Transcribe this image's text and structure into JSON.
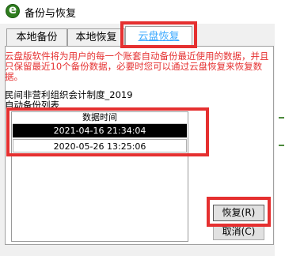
{
  "window": {
    "title": "备份与恢复",
    "icon": "app-e-icon"
  },
  "tabs": [
    {
      "label": "本地备份"
    },
    {
      "label": "本地恢复"
    },
    {
      "label": "云盘恢复"
    }
  ],
  "active_tab": "云盘恢复",
  "notice": "云盘版软件将为用户的每一个账套自动备份最近使用的数据，并且只保留最近10个备份数据，必要时您可以通过云盘恢复来恢复数据。",
  "account_name": "民间非营利组织会计制度_2019",
  "backup_list": {
    "label": "自动备份列表",
    "column_header": "数据时间",
    "rows": [
      "2021-04-16 21:34:04",
      "2020-05-26 13:25:06"
    ],
    "selected_index": 0
  },
  "buttons": {
    "restore": "恢复(R)",
    "cancel": "取消(C)"
  },
  "colors": {
    "highlight": "#e53030",
    "notice_text": "#e53030",
    "active_tab_text": "#3aa8ff",
    "selected_row_bg": "#000000"
  }
}
